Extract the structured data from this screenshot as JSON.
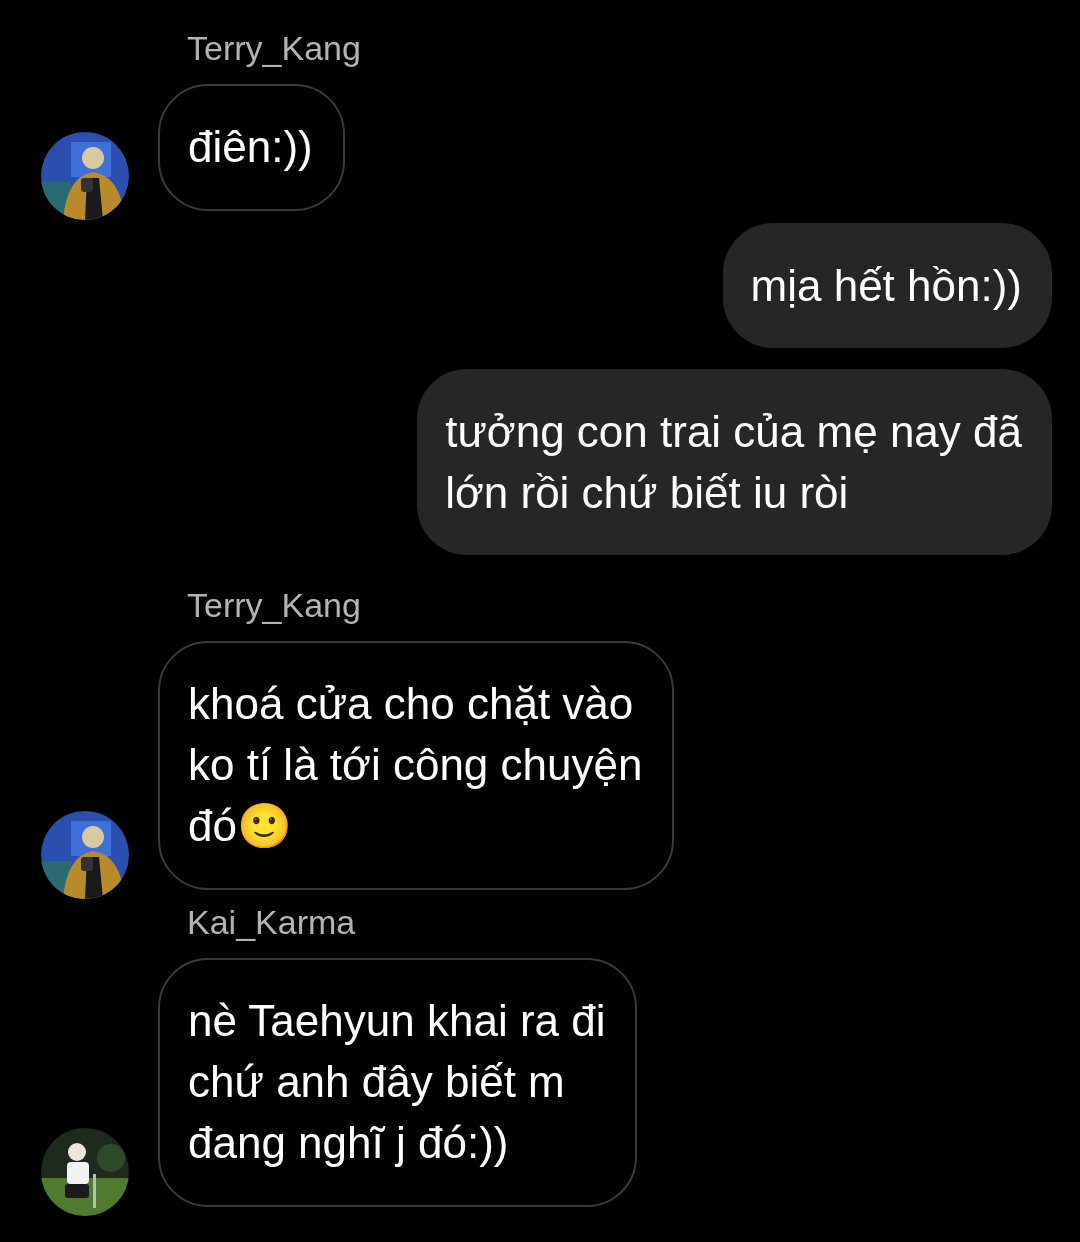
{
  "messages": [
    {
      "kind": "received",
      "sender": "Terry_Kang",
      "avatar": {
        "kind": "picture"
      },
      "lines": [
        "điên:))"
      ]
    },
    {
      "kind": "sent",
      "lines": [
        "mịa hết hồn:))"
      ]
    },
    {
      "kind": "sent",
      "lines": [
        "tưởng con trai của mẹ nay đã",
        "lớn rồi chứ biết iu ròi"
      ]
    },
    {
      "kind": "received",
      "sender": "Terry_Kang",
      "avatar": {
        "kind": "picture"
      },
      "lines": [
        "khoá cửa cho chặt vào",
        "ko tí là tới công chuyện",
        "đó🙂"
      ]
    },
    {
      "kind": "received",
      "sender": "Kai_Karma",
      "avatar": {
        "kind": "picture"
      },
      "lines": [
        "nè Taehyun khai ra đi",
        "chứ anh đây biết m",
        "đang nghĩ j đó:))"
      ]
    }
  ]
}
